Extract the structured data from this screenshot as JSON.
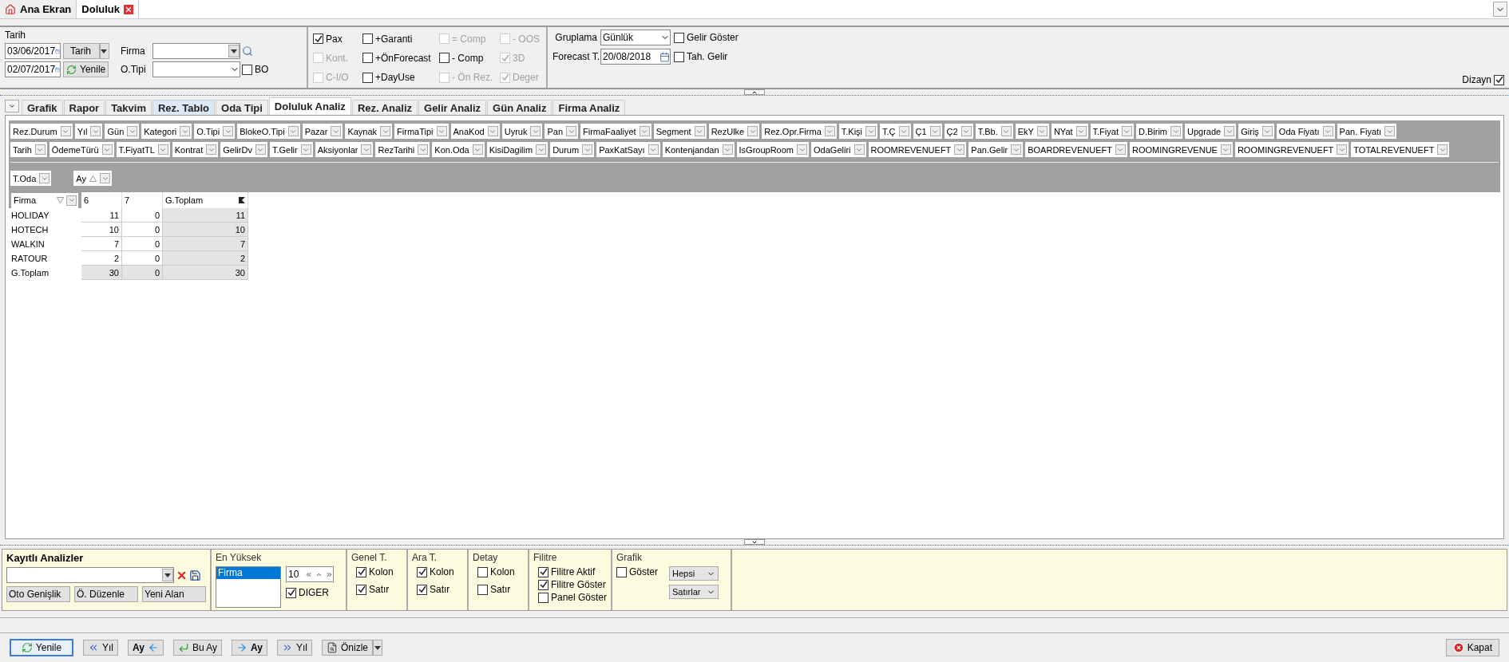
{
  "doc_tabs": [
    {
      "label": "Ana Ekran",
      "selected": false,
      "closable": false
    },
    {
      "label": "Doluluk",
      "selected": true,
      "closable": true
    }
  ],
  "date_group": {
    "title": "Tarih",
    "start_date": "03/06/2017",
    "end_date": "02/07/2017",
    "date_button": "Tarih",
    "refresh_button": "Yenile",
    "firma_label": "Firma",
    "room_type_label": "O.Tipi",
    "bo": {
      "label": "BO",
      "checked": false
    }
  },
  "options": [
    {
      "label": "Pax",
      "checked": true,
      "disabled": false
    },
    {
      "label": "+Garanti",
      "checked": false,
      "disabled": false
    },
    {
      "label": "= Comp",
      "checked": false,
      "disabled": true
    },
    {
      "label": "- OOS",
      "checked": false,
      "disabled": true
    },
    {
      "label": "Kont.",
      "checked": false,
      "disabled": true
    },
    {
      "label": "+ÖnForecast",
      "checked": false,
      "disabled": false
    },
    {
      "label": "- Comp",
      "checked": false,
      "disabled": false
    },
    {
      "label": "3D",
      "checked": true,
      "disabled": true
    },
    {
      "label": "C-I/O",
      "checked": false,
      "disabled": true
    },
    {
      "label": "+DayUse",
      "checked": false,
      "disabled": false
    },
    {
      "label": "- Ön Rez.",
      "checked": false,
      "disabled": true
    },
    {
      "label": "Deger",
      "checked": true,
      "disabled": true
    }
  ],
  "grouping": {
    "label": "Gruplama",
    "value": "Günlük",
    "forecast_label": "Forecast T.",
    "forecast_date": "20/08/2018",
    "checks": [
      {
        "label": "Gelir Göster",
        "checked": false
      },
      {
        "label": "Tah. Gelir",
        "checked": false
      }
    ],
    "design": {
      "label": "Dizayn",
      "checked": true
    }
  },
  "analysis_tabs": [
    {
      "label": "Grafik",
      "selected": false,
      "highlighted": false
    },
    {
      "label": "Rapor",
      "selected": false,
      "highlighted": false
    },
    {
      "label": "Takvim",
      "selected": false,
      "highlighted": false
    },
    {
      "label": "Rez. Tablo",
      "selected": false,
      "highlighted": true
    },
    {
      "label": "Oda Tipi",
      "selected": false,
      "highlighted": false
    },
    {
      "label": "Doluluk Analiz",
      "selected": true,
      "highlighted": false
    },
    {
      "label": "Rez. Analiz",
      "selected": false,
      "highlighted": false
    },
    {
      "label": "Gelir Analiz",
      "selected": false,
      "highlighted": false
    },
    {
      "label": "Gün Analiz",
      "selected": false,
      "highlighted": false
    },
    {
      "label": "Firma Analiz",
      "selected": false,
      "highlighted": false
    }
  ],
  "field_chips": [
    [
      "Rez.Durum",
      "Yıl",
      "Gün",
      "Kategori",
      "O.Tipi",
      "BlokeO.Tipi",
      "Pazar",
      "Kaynak",
      "FirmaTipi",
      "AnaKod",
      "Uyruk",
      "Pan",
      "FirmaFaaliyet",
      "Segment",
      "RezUlke",
      "Rez.Opr.Firma",
      "T.Kişi",
      "T.Ç",
      "Ç1",
      "Ç2",
      "T.Bb.",
      "EkY",
      "NYat",
      "T.Fiyat",
      "D.Birim",
      "Upgrade",
      "Giriş",
      "Oda Fiyatı",
      "Pan. Fiyatı"
    ],
    [
      "Tarih",
      "ÖdemeTürü",
      "T.FiyatTL",
      "Kontrat",
      "GelirDv",
      "T.Gelir",
      "Aksiyonlar",
      "RezTarihi",
      "Kon.Oda",
      "KisiDagilim",
      "Durum",
      "PaxKatSayı",
      "Kontenjandan",
      "IsGroupRoom",
      "OdaGeliri",
      "ROOMREVENUEFT",
      "Pan.Gelir",
      "BOARDREVENUEFT",
      "ROOMINGREVENUE",
      "ROOMINGREVENUEFT",
      "TOTALREVENUEFT"
    ]
  ],
  "data_field": {
    "label": "T.Oda"
  },
  "column_field": {
    "label": "Ay",
    "sort_ascending": true
  },
  "row_field": {
    "label": "Firma",
    "sort_ascending": false
  },
  "pivot": {
    "columns": [
      "6",
      "7",
      "G.Toplam"
    ],
    "rows": [
      {
        "label": "HOLIDAY",
        "kind": "data",
        "values": [
          "11",
          "0",
          "11"
        ]
      },
      {
        "label": "HOTECH",
        "kind": "data",
        "values": [
          "10",
          "0",
          "10"
        ]
      },
      {
        "label": "WALKIN",
        "kind": "data",
        "values": [
          "7",
          "0",
          "7"
        ]
      },
      {
        "label": "RATOUR",
        "kind": "data",
        "values": [
          "2",
          "0",
          "2"
        ]
      },
      {
        "label": "G.Toplam",
        "kind": "total",
        "values": [
          "30",
          "0",
          "30"
        ]
      }
    ]
  },
  "saved": {
    "title": "Kayıtlı Analizler",
    "buttons": [
      "Oto Genişlik",
      "Ö. Düzenle",
      "Yeni Alan"
    ]
  },
  "top": {
    "title": "En Yüksek",
    "list": [
      {
        "label": "Firma",
        "selected": true
      }
    ],
    "count": "10",
    "other": {
      "label": "DIGER",
      "checked": true
    }
  },
  "check_groups": [
    {
      "title": "Genel T.",
      "items": [
        {
          "label": "Kolon",
          "checked": true
        },
        {
          "label": "Satır",
          "checked": true
        }
      ]
    },
    {
      "title": "Ara T.",
      "items": [
        {
          "label": "Kolon",
          "checked": true
        },
        {
          "label": "Satır",
          "checked": true
        }
      ]
    },
    {
      "title": "Detay",
      "items": [
        {
          "label": "Kolon",
          "checked": false
        },
        {
          "label": "Satır",
          "checked": false
        }
      ]
    },
    {
      "title": "Filitre",
      "items": [
        {
          "label": "Filitre Aktif",
          "checked": true
        },
        {
          "label": "Filitre Göster",
          "checked": true
        },
        {
          "label": "Panel Göster",
          "checked": false
        }
      ]
    }
  ],
  "chart": {
    "title": "Grafik",
    "show": {
      "label": "Göster",
      "checked": false
    },
    "selects": [
      "Hepsi",
      "Satırlar"
    ]
  },
  "toolbar": [
    {
      "label": "Yenile",
      "kind": "refresh",
      "primary": true,
      "bold": false,
      "icon_after": false,
      "dropdown": false
    },
    {
      "label": "Yıl",
      "kind": "double-left",
      "primary": false,
      "bold": false,
      "icon_after": false,
      "dropdown": false
    },
    {
      "label": "Ay",
      "kind": "arrow-left",
      "primary": false,
      "bold": true,
      "icon_after": true,
      "dropdown": false
    },
    {
      "label": "Bu Ay",
      "kind": "return",
      "primary": false,
      "bold": false,
      "icon_after": false,
      "dropdown": false
    },
    {
      "label": "Ay",
      "kind": "arrow-right",
      "primary": false,
      "bold": true,
      "icon_after": false,
      "dropdown": false
    },
    {
      "label": "Yıl",
      "kind": "double-right",
      "primary": false,
      "bold": false,
      "icon_after": false,
      "dropdown": false
    },
    {
      "label": "Önizle",
      "kind": "preview",
      "primary": false,
      "bold": false,
      "icon_after": false,
      "dropdown": true
    }
  ],
  "close_button": "Kapat"
}
